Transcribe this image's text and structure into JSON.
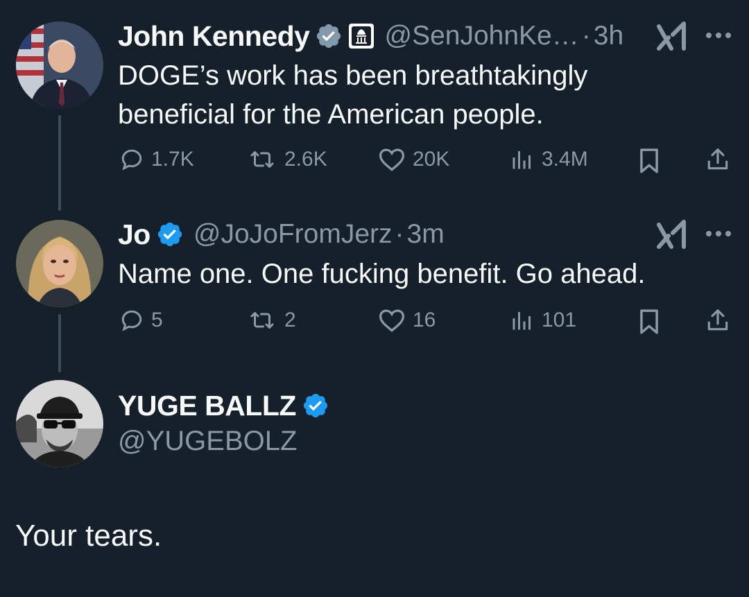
{
  "tweets": [
    {
      "display_name": "John Kennedy",
      "handle": "@SenJohnKe…",
      "separator": "·",
      "time": "3h",
      "text_line1": "DOGE’s work has been breathtakingly",
      "text_line2": "beneficial for the American people.",
      "replies": "1.7K",
      "retweets": "2.6K",
      "likes": "20K",
      "views": "3.4M"
    },
    {
      "display_name": "Jo",
      "handle": "@JoJoFromJerz",
      "separator": "·",
      "time": "3m",
      "text": "Name one. One fucking benefit. Go ahead.",
      "replies": "5",
      "retweets": "2",
      "likes": "16",
      "views": "101"
    }
  ],
  "reply": {
    "display_name": "YUGE BALLZ",
    "handle": "@YUGEBOLZ",
    "text": "Your tears."
  },
  "colors": {
    "background": "#15202b",
    "text_primary": "#f7f9f9",
    "text_secondary": "#8b98a5",
    "verified_blue": "#1d9bf0",
    "government_gray": "#829aab",
    "thread_line": "#3e4c5a"
  },
  "icons": [
    "verified-badge-icon",
    "government-badge-icon",
    "grok-icon",
    "more-icon",
    "reply-icon",
    "retweet-icon",
    "like-icon",
    "views-icon",
    "bookmark-icon",
    "share-icon"
  ]
}
